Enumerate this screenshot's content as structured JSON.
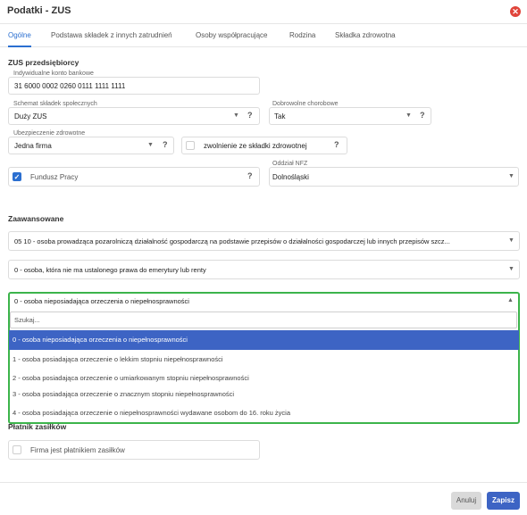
{
  "dialog": {
    "title": "Podatki - ZUS",
    "close_symbol": "✕",
    "accent_color": "#3d64c4",
    "focus_color": "#3cb44b",
    "close_color": "#e0443a"
  },
  "tabs": [
    {
      "label": "Ogólne",
      "active": true
    },
    {
      "label": "Podstawa składek z innych zatrudnień",
      "active": false
    },
    {
      "label": "Osoby współpracujące",
      "active": false
    },
    {
      "label": "Rodzina",
      "active": false
    },
    {
      "label": "Składka zdrowotna",
      "active": false
    }
  ],
  "zus": {
    "section_title": "ZUS przedsiębiorcy",
    "bank_account": {
      "label": "Indywidualne konto bankowe",
      "value": "31 6000 0002 0260 0111 1111 1111"
    },
    "social_scheme": {
      "label": "Schemat składek społecznych",
      "value": "Duży ZUS"
    },
    "voluntary_sickness": {
      "label": "Dobrowolne chorobowe",
      "value": "Tak"
    },
    "health_insurance": {
      "label": "Ubezpieczenie zdrowotne",
      "value": "Jedna firma"
    },
    "health_exemption": {
      "label": "zwolnienie ze składki zdrowotnej",
      "checked": false
    },
    "labor_fund": {
      "label": "Fundusz Pracy",
      "checked": true
    },
    "nfz_branch": {
      "label": "Oddział NFZ",
      "value": "Dolnośląski"
    },
    "help_symbol": "?",
    "caret_symbol": "▼",
    "caret_up_symbol": "▲",
    "check_symbol": "✓"
  },
  "advanced": {
    "section_title": "Zaawansowane",
    "title_code": "05 10 - osoba prowadząca pozarolniczą działalność gospodarczą na podstawie przepisów o działalności gospodarczej lub innych przepisów szcz...",
    "pension_right": "0 - osoba, która nie ma ustalonego prawa do emerytury lub renty",
    "disability": {
      "value": "0 - osoba nieposiadająca orzeczenia o niepełnosprawności",
      "search_placeholder": "Szukaj...",
      "options": [
        {
          "label": "0 - osoba nieposiadająca orzeczenia o niepełnosprawności",
          "selected": true
        },
        {
          "label": "1 - osoba posiadająca orzeczenie o lekkim stopniu niepełnosprawności",
          "selected": false
        },
        {
          "label": "2 - osoba posiadająca orzeczenie o umiarkowanym stopniu niepełnosprawności",
          "selected": false
        },
        {
          "label": "3 - osoba posiadająca orzeczenie o znacznym stopniu niepełnosprawności",
          "selected": false
        },
        {
          "label": "4 - osoba posiadająca orzeczenie o niepełnosprawności wydawane osobom do 16. roku życia",
          "selected": false
        }
      ]
    }
  },
  "allowance_payer": {
    "section_title": "Płatnik zasiłków",
    "checkbox_label": "Firma jest płatnikiem zasiłków",
    "checked": false
  },
  "footer": {
    "cancel_label": "Anuluj",
    "save_label": "Zapisz"
  }
}
